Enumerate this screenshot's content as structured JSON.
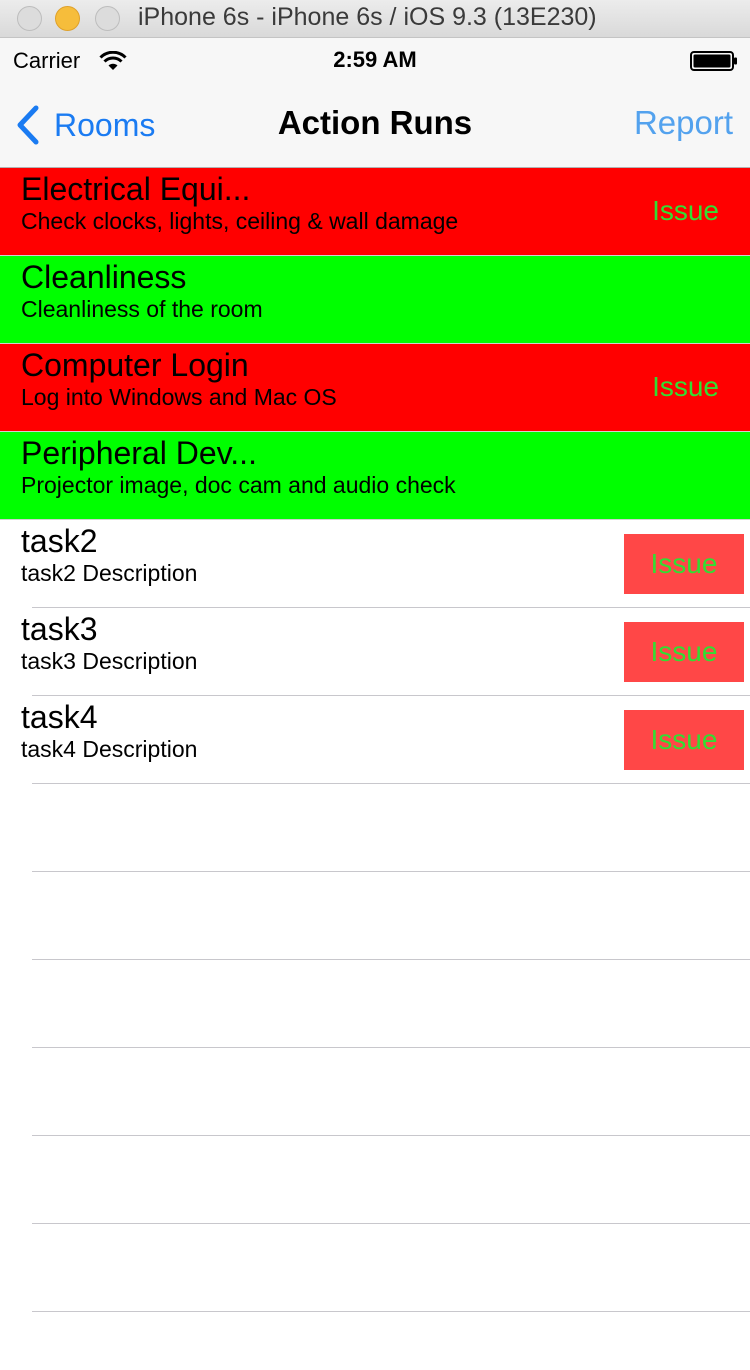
{
  "simulator": {
    "title": "iPhone 6s - iPhone 6s / iOS 9.3 (13E230)"
  },
  "status_bar": {
    "carrier": "Carrier",
    "time": "2:59 AM",
    "wifi_icon": "wifi-icon",
    "battery_icon": "battery-full-icon"
  },
  "nav": {
    "back_label": "Rooms",
    "title": "Action Runs",
    "report_label": "Report",
    "accent_color": "#1a7bf2"
  },
  "colors": {
    "issue_row": "#ff0000",
    "ok_row": "#00ff00",
    "issue_text": "#33dd33",
    "issue_button": "#ff4747"
  },
  "rows": [
    {
      "title": "Electrical Equi...",
      "subtitle": "Check clocks, lights, ceiling & wall damage",
      "status": "issue",
      "issue_label": "Issue"
    },
    {
      "title": "Cleanliness",
      "subtitle": "Cleanliness of the room",
      "status": "ok",
      "issue_label": ""
    },
    {
      "title": "Computer Login",
      "subtitle": "Log into Windows and Mac OS",
      "status": "issue",
      "issue_label": "Issue"
    },
    {
      "title": "Peripheral Dev...",
      "subtitle": "Projector image, doc cam and audio check",
      "status": "ok",
      "issue_label": ""
    },
    {
      "title": "task2",
      "subtitle": "task2 Description",
      "status": "pending",
      "issue_label": "Issue"
    },
    {
      "title": "task3",
      "subtitle": "task3 Description",
      "status": "pending",
      "issue_label": "Issue"
    },
    {
      "title": "task4",
      "subtitle": "task4 Description",
      "status": "pending",
      "issue_label": "Issue"
    }
  ]
}
